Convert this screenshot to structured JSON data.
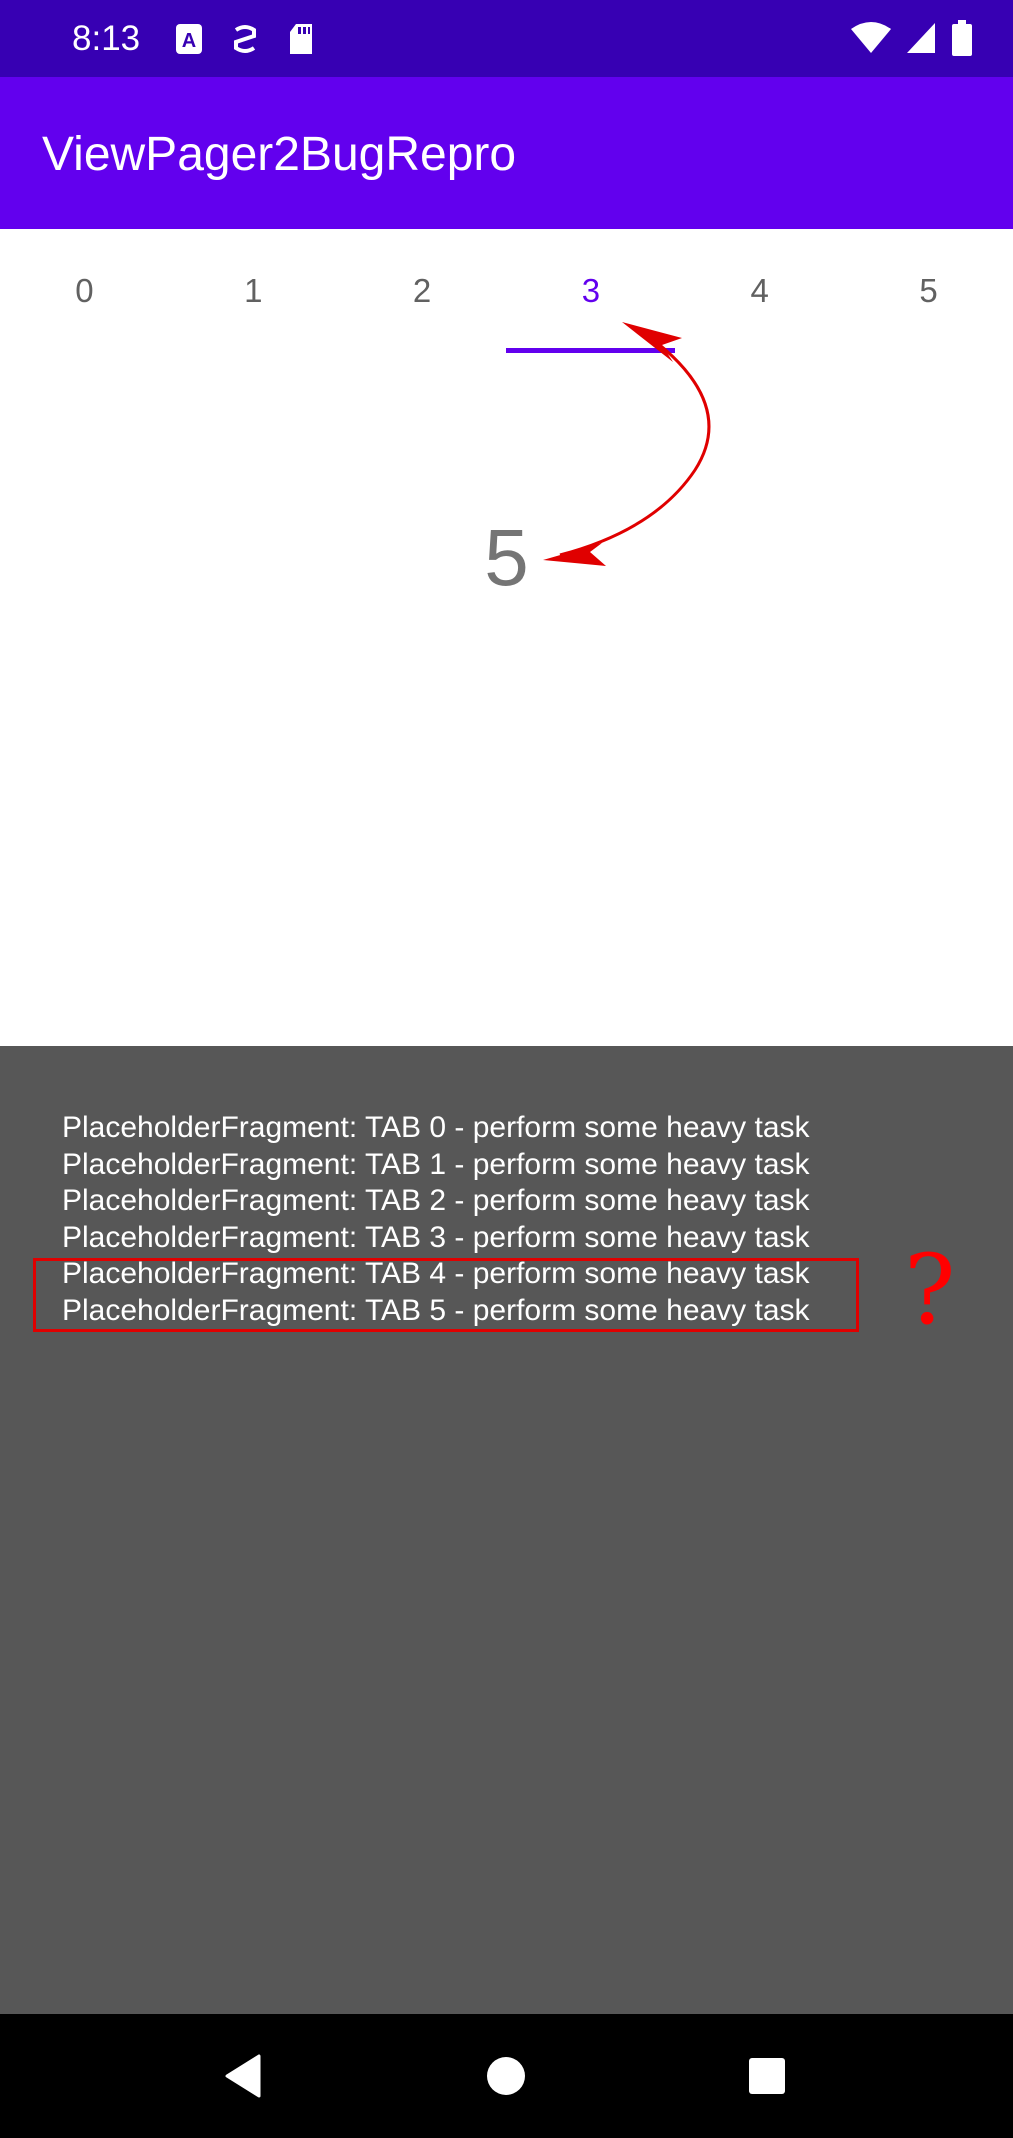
{
  "status_bar": {
    "time": "8:13",
    "left_icons": [
      "font-notification-icon",
      "sim-toolkit-icon",
      "sd-card-icon"
    ],
    "right_icons": [
      "wifi-icon",
      "cell-signal-icon",
      "battery-icon"
    ]
  },
  "app_bar": {
    "title": "ViewPager2BugRepro"
  },
  "tabs": [
    {
      "label": "0"
    },
    {
      "label": "1"
    },
    {
      "label": "2"
    },
    {
      "label": "3",
      "selected": true
    },
    {
      "label": "4"
    },
    {
      "label": "5"
    }
  ],
  "page": {
    "number": "5"
  },
  "log": {
    "lines": [
      "PlaceholderFragment: TAB 0 - perform some heavy task",
      "PlaceholderFragment: TAB 1 - perform some heavy task",
      "PlaceholderFragment: TAB 2 - perform some heavy task",
      "PlaceholderFragment: TAB 3 - perform some heavy task",
      "PlaceholderFragment: TAB 4 - perform some heavy task",
      "PlaceholderFragment: TAB 5 - perform some heavy task"
    ]
  },
  "annotation": {
    "question": "?",
    "color": "#ff0000"
  },
  "colors": {
    "primary": "#6200ee",
    "primary_dark": "#3700b3",
    "log_bg": "#575757"
  },
  "nav_bar": {
    "buttons": [
      "back-icon",
      "home-icon",
      "recents-icon"
    ]
  }
}
